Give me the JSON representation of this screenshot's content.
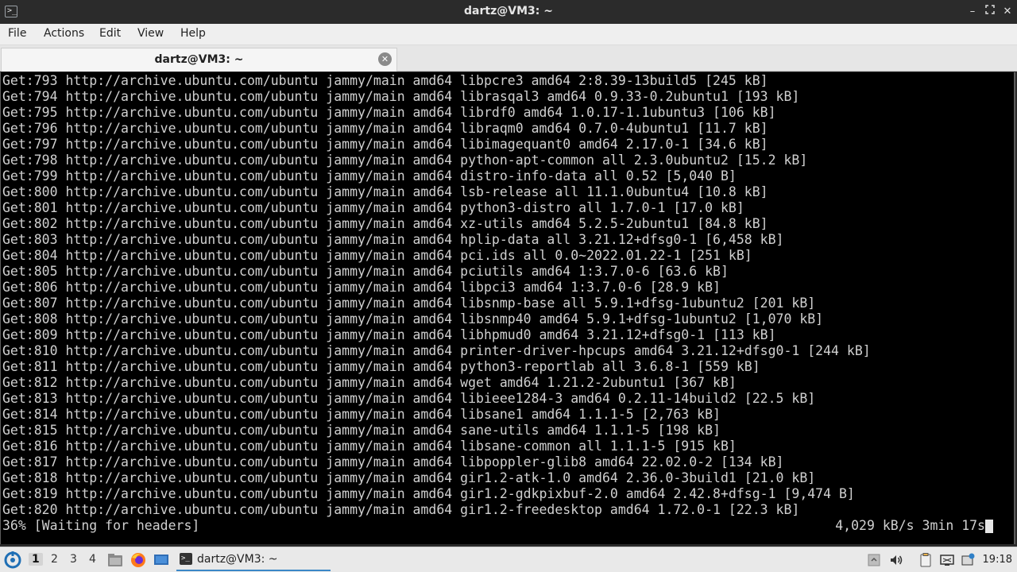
{
  "window": {
    "title": "dartz@VM3: ~"
  },
  "menu": [
    "File",
    "Actions",
    "Edit",
    "View",
    "Help"
  ],
  "tab": {
    "label": "dartz@VM3: ~"
  },
  "terminal": {
    "lines": [
      "Get:793 http://archive.ubuntu.com/ubuntu jammy/main amd64 libpcre3 amd64 2:8.39-13build5 [245 kB]",
      "Get:794 http://archive.ubuntu.com/ubuntu jammy/main amd64 librasqal3 amd64 0.9.33-0.2ubuntu1 [193 kB]",
      "Get:795 http://archive.ubuntu.com/ubuntu jammy/main amd64 librdf0 amd64 1.0.17-1.1ubuntu3 [106 kB]",
      "Get:796 http://archive.ubuntu.com/ubuntu jammy/main amd64 libraqm0 amd64 0.7.0-4ubuntu1 [11.7 kB]",
      "Get:797 http://archive.ubuntu.com/ubuntu jammy/main amd64 libimagequant0 amd64 2.17.0-1 [34.6 kB]",
      "Get:798 http://archive.ubuntu.com/ubuntu jammy/main amd64 python-apt-common all 2.3.0ubuntu2 [15.2 kB]",
      "Get:799 http://archive.ubuntu.com/ubuntu jammy/main amd64 distro-info-data all 0.52 [5,040 B]",
      "Get:800 http://archive.ubuntu.com/ubuntu jammy/main amd64 lsb-release all 11.1.0ubuntu4 [10.8 kB]",
      "Get:801 http://archive.ubuntu.com/ubuntu jammy/main amd64 python3-distro all 1.7.0-1 [17.0 kB]",
      "Get:802 http://archive.ubuntu.com/ubuntu jammy/main amd64 xz-utils amd64 5.2.5-2ubuntu1 [84.8 kB]",
      "Get:803 http://archive.ubuntu.com/ubuntu jammy/main amd64 hplip-data all 3.21.12+dfsg0-1 [6,458 kB]",
      "Get:804 http://archive.ubuntu.com/ubuntu jammy/main amd64 pci.ids all 0.0~2022.01.22-1 [251 kB]",
      "Get:805 http://archive.ubuntu.com/ubuntu jammy/main amd64 pciutils amd64 1:3.7.0-6 [63.6 kB]",
      "Get:806 http://archive.ubuntu.com/ubuntu jammy/main amd64 libpci3 amd64 1:3.7.0-6 [28.9 kB]",
      "Get:807 http://archive.ubuntu.com/ubuntu jammy/main amd64 libsnmp-base all 5.9.1+dfsg-1ubuntu2 [201 kB]",
      "Get:808 http://archive.ubuntu.com/ubuntu jammy/main amd64 libsnmp40 amd64 5.9.1+dfsg-1ubuntu2 [1,070 kB]",
      "Get:809 http://archive.ubuntu.com/ubuntu jammy/main amd64 libhpmud0 amd64 3.21.12+dfsg0-1 [113 kB]",
      "Get:810 http://archive.ubuntu.com/ubuntu jammy/main amd64 printer-driver-hpcups amd64 3.21.12+dfsg0-1 [244 kB]",
      "Get:811 http://archive.ubuntu.com/ubuntu jammy/main amd64 python3-reportlab all 3.6.8-1 [559 kB]",
      "Get:812 http://archive.ubuntu.com/ubuntu jammy/main amd64 wget amd64 1.21.2-2ubuntu1 [367 kB]",
      "Get:813 http://archive.ubuntu.com/ubuntu jammy/main amd64 libieee1284-3 amd64 0.2.11-14build2 [22.5 kB]",
      "Get:814 http://archive.ubuntu.com/ubuntu jammy/main amd64 libsane1 amd64 1.1.1-5 [2,763 kB]",
      "Get:815 http://archive.ubuntu.com/ubuntu jammy/main amd64 sane-utils amd64 1.1.1-5 [198 kB]",
      "Get:816 http://archive.ubuntu.com/ubuntu jammy/main amd64 libsane-common all 1.1.1-5 [915 kB]",
      "Get:817 http://archive.ubuntu.com/ubuntu jammy/main amd64 libpoppler-glib8 amd64 22.02.0-2 [134 kB]",
      "Get:818 http://archive.ubuntu.com/ubuntu jammy/main amd64 gir1.2-atk-1.0 amd64 2.36.0-3build1 [21.0 kB]",
      "Get:819 http://archive.ubuntu.com/ubuntu jammy/main amd64 gir1.2-gdkpixbuf-2.0 amd64 2.42.8+dfsg-1 [9,474 B]",
      "Get:820 http://archive.ubuntu.com/ubuntu jammy/main amd64 gir1.2-freedesktop amd64 1.72.0-1 [22.3 kB]"
    ],
    "status_left": "36% [Waiting for headers]",
    "status_right": "4,029 kB/s 3min 17s"
  },
  "taskbar": {
    "workspaces": [
      "1",
      "2",
      "3",
      "4"
    ],
    "active_workspace": "1",
    "task_label": "dartz@VM3: ~",
    "clock": "19:18"
  }
}
